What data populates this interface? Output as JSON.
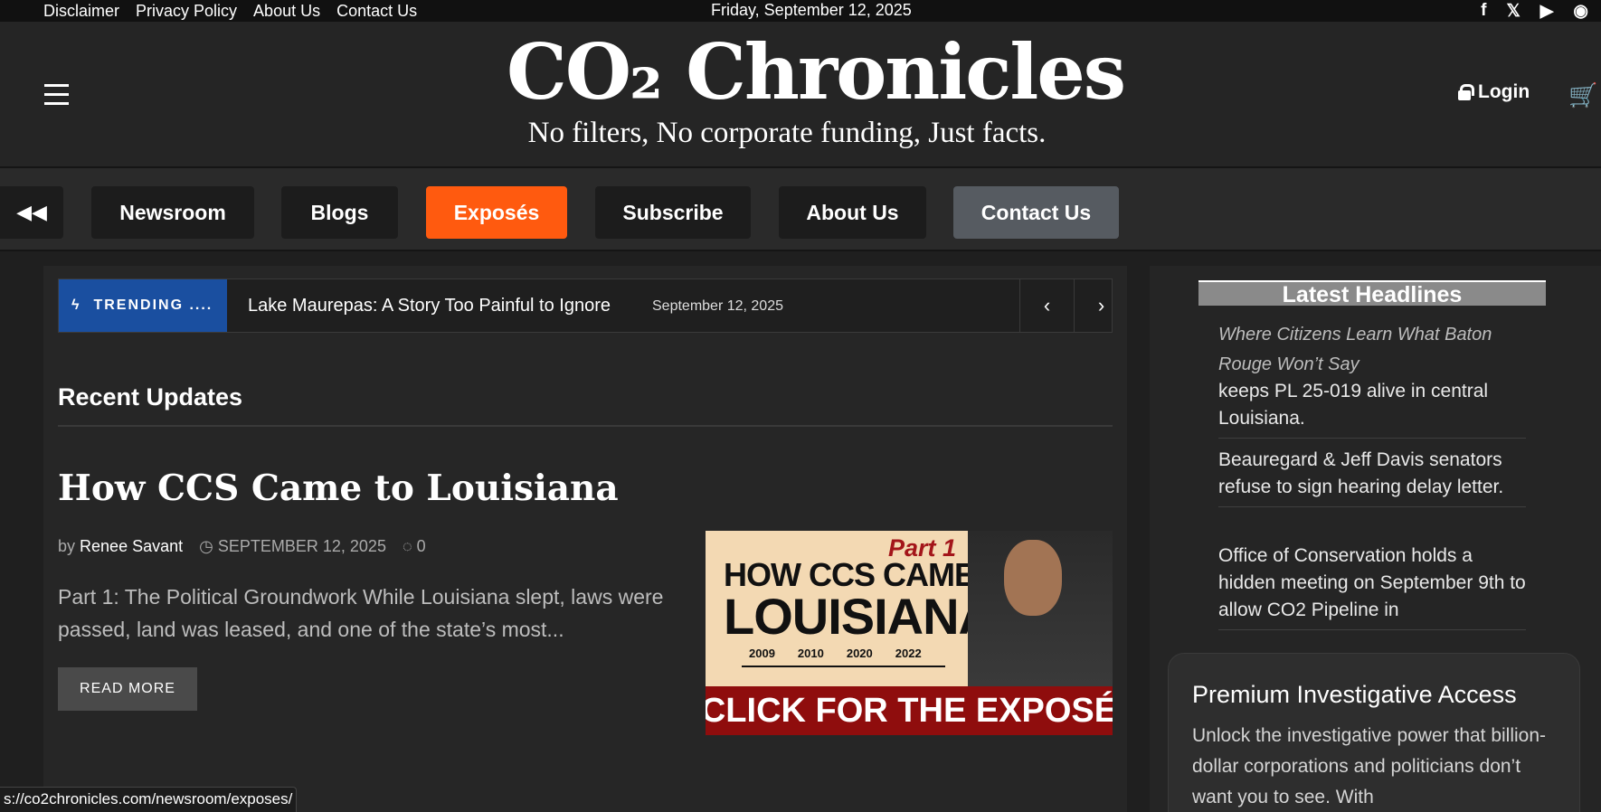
{
  "topbar": {
    "links": [
      "Disclaimer",
      "Privacy Policy",
      "About Us",
      "Contact Us"
    ],
    "date": "Friday, September 12, 2025",
    "social": [
      "f",
      "𝕏",
      "▶",
      "◉"
    ]
  },
  "header": {
    "logo_title": "CO₂ Chronicles",
    "logo_tagline": "No filters, No corporate funding, Just facts.",
    "login_label": "Login",
    "cart_icon": "🛒"
  },
  "nav": {
    "back_icon": "◀◀",
    "items": [
      "Newsroom",
      "Blogs",
      "Exposés",
      "Subscribe",
      "About Us",
      "Contact Us"
    ],
    "active": "Exposés"
  },
  "trending": {
    "label": "TRENDING ....",
    "headline": "Lake Maurepas: A Story Too Painful to Ignore",
    "date": "September 12, 2025",
    "prev_icon": "‹",
    "next_icon": "›"
  },
  "recent": {
    "section_title": "Recent Updates",
    "post": {
      "title": "How CCS Came to Louisiana",
      "by": "by",
      "author": "Renee Savant",
      "date": "SEPTEMBER 12, 2025",
      "comments": "0",
      "excerpt": "Part 1: The Political Groundwork While Louisiana slept, laws were passed, land was leased, and one of the state’s most...",
      "read_more": "READ MORE",
      "image": {
        "part": "Part 1",
        "headline_1": "HOW CCS CAME TO",
        "headline_2": "LOUISIANA",
        "years": [
          "2009",
          "2010",
          "2020",
          "2022"
        ],
        "cta": "CLICK FOR THE EXPOSÉ"
      }
    }
  },
  "sidebar": {
    "title": "Latest Headlines",
    "intro": "Where Citizens Learn What Baton Rouge Won’t Say",
    "items": [
      "keeps PL 25-019 alive in central Louisiana.",
      "Beauregard & Jeff Davis senators refuse to sign hearing delay letter.",
      "Office of Conservation holds a hidden meeting on September 9th to allow CO2 Pipeline in"
    ],
    "premium_title": "Premium Investigative Access",
    "premium_body": "Unlock the investigative power that billion-dollar corporations and politicians don’t want you to see. With"
  },
  "status_url": "s://co2chronicles.com/newsroom/exposes/"
}
